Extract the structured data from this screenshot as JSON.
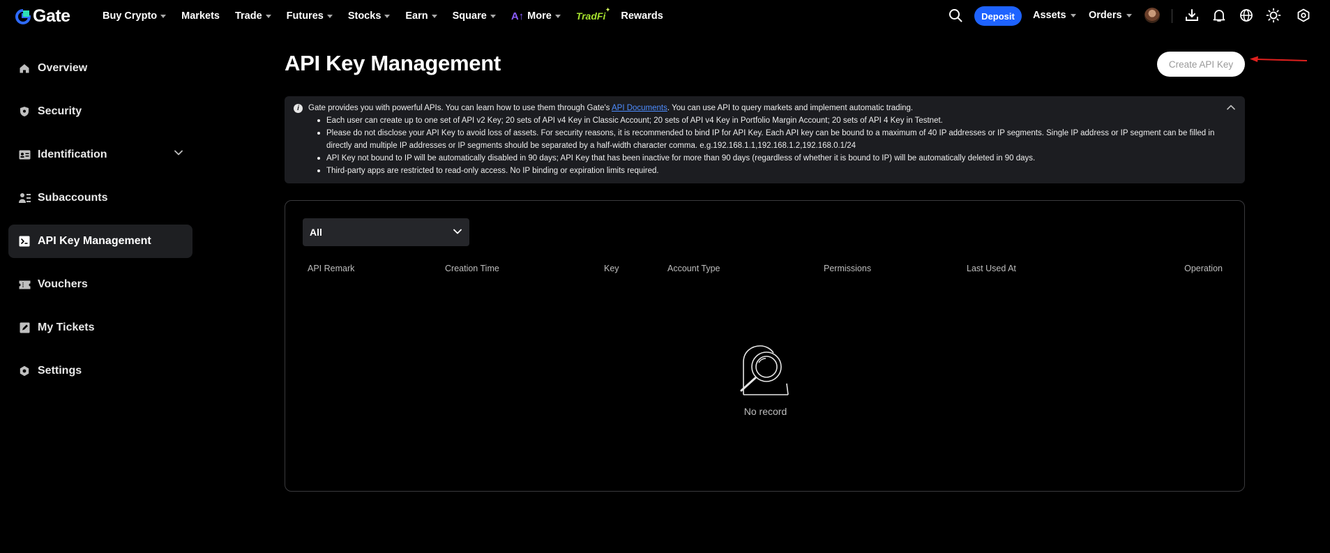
{
  "brand": {
    "logo_text": "Gate"
  },
  "nav": {
    "items": [
      {
        "label": "Buy Crypto",
        "caret": true
      },
      {
        "label": "Markets",
        "caret": false
      },
      {
        "label": "Trade",
        "caret": true
      },
      {
        "label": "Futures",
        "caret": true
      },
      {
        "label": "Stocks",
        "caret": true
      },
      {
        "label": "Earn",
        "caret": true
      },
      {
        "label": "Square",
        "caret": true
      },
      {
        "label": "More",
        "caret": true
      },
      {
        "label": "TradFi",
        "caret": false
      },
      {
        "label": "Rewards",
        "caret": false
      }
    ],
    "deposit_label": "Deposit",
    "assets_label": "Assets",
    "orders_label": "Orders"
  },
  "sidebar": {
    "items": [
      {
        "label": "Overview",
        "icon": "home-icon"
      },
      {
        "label": "Security",
        "icon": "shield-icon"
      },
      {
        "label": "Identification",
        "icon": "id-card-icon",
        "expandable": true
      },
      {
        "label": "Subaccounts",
        "icon": "subaccounts-icon"
      },
      {
        "label": "API Key Management",
        "icon": "terminal-icon",
        "active": true
      },
      {
        "label": "Vouchers",
        "icon": "ticket-icon"
      },
      {
        "label": "My Tickets",
        "icon": "edit-document-icon"
      },
      {
        "label": "Settings",
        "icon": "gear-icon"
      }
    ]
  },
  "main": {
    "title": "API Key Management",
    "create_button": "Create API Key",
    "notice": {
      "intro_before": "Gate provides you with powerful APIs. You can learn how to use them through Gate's ",
      "link_text": "API Documents",
      "intro_after": ". You can use API to query markets and implement automatic trading.",
      "bullets": [
        "Each user can create up to one set of API v2 Key; 20 sets of API v4 Key in Classic Account; 20 sets of API v4 Key in Portfolio Margin Account; 20 sets of API 4 Key in Testnet.",
        "Please do not disclose your API Key to avoid loss of assets. For security reasons, it is recommended to bind IP for API Key. Each API key can be bound to a maximum of 40 IP addresses or IP segments. Single IP address or IP segment can be filled in directly and multiple IP addresses or IP segments should be separated by a half-width character comma. e.g.192.168.1.1,192.168.1.2,192.168.0.1/24",
        "API Key not bound to IP will be automatically disabled in 90 days; API Key that has been inactive for more than 90 days (regardless of whether it is bound to IP) will be automatically deleted in 90 days.",
        "Third-party apps are restricted to read-only access. No IP binding or expiration limits required."
      ]
    },
    "filter": {
      "selected": "All"
    },
    "table": {
      "columns": [
        "API Remark",
        "Creation Time",
        "Key",
        "Account Type",
        "Permissions",
        "Last Used At",
        "Operation"
      ],
      "rows": [],
      "empty_text": "No record"
    }
  },
  "colors": {
    "accent": "#1e63ff",
    "background": "#000000",
    "link": "#4e8dff",
    "tradfi": "#a6e22e",
    "annotation_arrow": "#e0201e"
  }
}
